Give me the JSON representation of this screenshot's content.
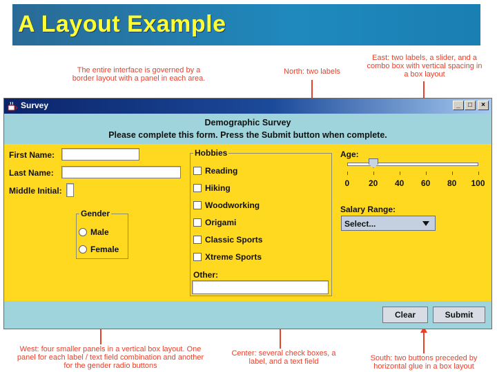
{
  "slide": {
    "title": "A Layout Example"
  },
  "notes": {
    "border_layout": "The entire interface is governed by a border layout with a panel in each area.",
    "north": "North: two labels",
    "east": "East: two labels, a slider, and a combo box with vertical spacing in a box layout",
    "west": "West: four smaller panels in a vertical box layout. One panel for each label / text field combination and another for the gender radio buttons",
    "center": "Center: several check boxes, a label, and a text field",
    "south": "South: two buttons preceded by horizontal glue in a box layout"
  },
  "window": {
    "title": "Survey",
    "controls": {
      "minimize": "_",
      "maximize": "□",
      "close": "×"
    }
  },
  "north": {
    "line1": "Demographic Survey",
    "line2": "Please complete this form. Press the Submit button when complete."
  },
  "west": {
    "first_name": {
      "label": "First Name:",
      "value": ""
    },
    "last_name": {
      "label": "Last Name:",
      "value": ""
    },
    "middle_initial": {
      "label": "Middle Initial:",
      "value": ""
    },
    "gender": {
      "title": "Gender",
      "options": [
        "Male",
        "Female"
      ]
    }
  },
  "center": {
    "hobbies_title": "Hobbies",
    "hobbies": [
      "Reading",
      "Hiking",
      "Woodworking",
      "Origami",
      "Classic Sports",
      "Xtreme Sports"
    ],
    "other_label": "Other:",
    "other_value": ""
  },
  "east": {
    "age_label": "Age:",
    "age_value": 20,
    "age_min": 0,
    "age_max": 100,
    "age_ticks": [
      "0",
      "20",
      "40",
      "60",
      "80",
      "100"
    ],
    "salary_label": "Salary Range:",
    "salary_selected": "Select..."
  },
  "south": {
    "clear_label": "Clear",
    "submit_label": "Submit"
  },
  "colors": {
    "header_blue": "#1f89bd",
    "title_yellow": "#ffff33",
    "annotation_red": "#e8402a",
    "panel_yellow": "#ffd820",
    "panel_cyan": "#9fd4dc"
  }
}
